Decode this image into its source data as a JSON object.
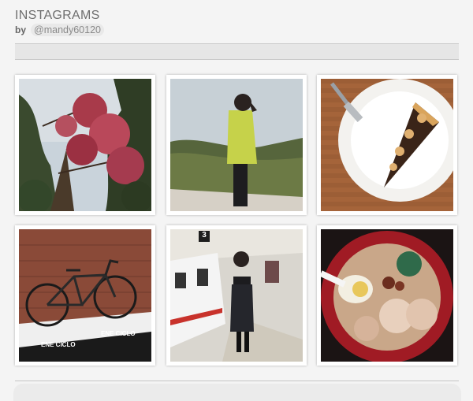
{
  "widget": {
    "title": "INSTAGRAMS",
    "by_label": "by",
    "handle": "@mandy60120"
  },
  "photos": [
    {
      "icon": "cherry-blossom-tree-photo"
    },
    {
      "icon": "person-on-hill-photo"
    },
    {
      "icon": "cake-slice-photo"
    },
    {
      "icon": "bicycle-display-photo"
    },
    {
      "icon": "train-platform-photo"
    },
    {
      "icon": "ramen-bowl-photo"
    }
  ],
  "bike_sign": [
    "ENE CICLO",
    "ENE CICLO"
  ],
  "platform_sign": "3"
}
